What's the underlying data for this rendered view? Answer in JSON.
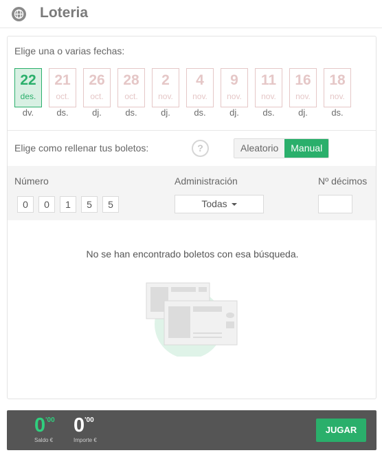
{
  "header": {
    "title": "Loteria",
    "icon": "globe-icon"
  },
  "dates": {
    "label": "Elige una o varias fechas:",
    "items": [
      {
        "day": "22",
        "month": "des.",
        "weekday": "dv.",
        "selected": true
      },
      {
        "day": "21",
        "month": "oct.",
        "weekday": "ds.",
        "selected": false
      },
      {
        "day": "26",
        "month": "oct.",
        "weekday": "dj.",
        "selected": false
      },
      {
        "day": "28",
        "month": "oct.",
        "weekday": "ds.",
        "selected": false
      },
      {
        "day": "2",
        "month": "nov.",
        "weekday": "dj.",
        "selected": false
      },
      {
        "day": "4",
        "month": "nov.",
        "weekday": "ds.",
        "selected": false
      },
      {
        "day": "9",
        "month": "nov.",
        "weekday": "dj.",
        "selected": false
      },
      {
        "day": "11",
        "month": "nov.",
        "weekday": "ds.",
        "selected": false
      },
      {
        "day": "16",
        "month": "nov.",
        "weekday": "dj.",
        "selected": false
      },
      {
        "day": "18",
        "month": "nov.",
        "weekday": "ds.",
        "selected": false
      }
    ]
  },
  "fill": {
    "label": "Elige como rellenar tus boletos:",
    "help": "?",
    "options": [
      "Aleatorio",
      "Manual"
    ],
    "active": "Manual"
  },
  "filters": {
    "numero_label": "Número",
    "digits": [
      "0",
      "0",
      "1",
      "5",
      "5"
    ],
    "admin_label": "Administración",
    "admin_value": "Todas",
    "decimos_label": "Nº décimos",
    "decimos_value": ""
  },
  "empty_message": "No se han encontrado boletos con esa búsqueda.",
  "bottom": {
    "saldo": {
      "value": "0",
      "cents": "'00",
      "caption": "Saldo €"
    },
    "importe": {
      "value": "0",
      "cents": "'00",
      "caption": "Importe €"
    },
    "play_label": "JUGAR"
  },
  "colors": {
    "accent": "#2aaf6b",
    "disabled_date": "#e5c7c7",
    "bar": "#555555"
  }
}
